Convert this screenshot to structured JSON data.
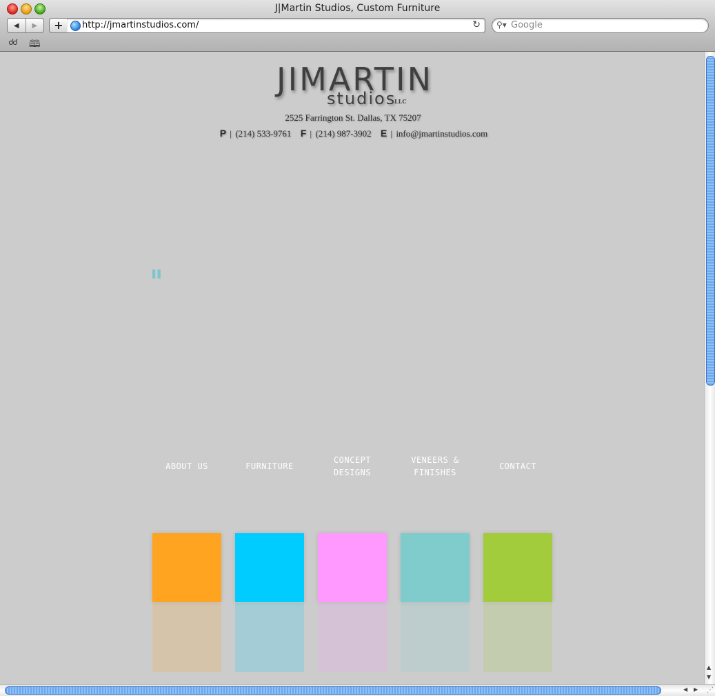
{
  "window": {
    "title": "J|Martin Studios, Custom Furniture"
  },
  "toolbar": {
    "back_glyph": "◀",
    "forward_glyph": "▶",
    "add_glyph": "+",
    "url": "http://jmartinstudios.com/",
    "reload_glyph": "↻",
    "search_placeholder": "Google",
    "search_glyph": "⚲▾",
    "bookmark_glasses_glyph": "☌☌",
    "bookmark_book_glyph": "🕮"
  },
  "header": {
    "logo_main": "JIMARTIN",
    "logo_sub": "studios",
    "logo_llc": "LLC",
    "address": "2525 Farrington St. Dallas, TX 75207",
    "phone_label": "P",
    "phone": "(214) 533-9761",
    "fax_label": "F",
    "fax": "(214) 987-3902",
    "email_label": "E",
    "email": "info@jmartinstudios.com",
    "separator": "|"
  },
  "loader_glyph": "▌▌",
  "nav": {
    "items": [
      {
        "line1": "ABOUT US",
        "line2": ""
      },
      {
        "line1": "FURNITURE",
        "line2": ""
      },
      {
        "line1": "CONCEPT",
        "line2": "DESIGNS"
      },
      {
        "line1": "VENEERS &",
        "line2": "FINISHES"
      },
      {
        "line1": "CONTACT",
        "line2": ""
      }
    ]
  },
  "swatches": {
    "colors": [
      "#ffa421",
      "#00ccff",
      "#ff99ff",
      "#80cccc",
      "#a3cc3c"
    ]
  },
  "scroll": {
    "up_glyph": "▲",
    "down_glyph": "▼",
    "left_glyph": "◀",
    "right_glyph": "▶",
    "resize_glyph": "⋰"
  }
}
